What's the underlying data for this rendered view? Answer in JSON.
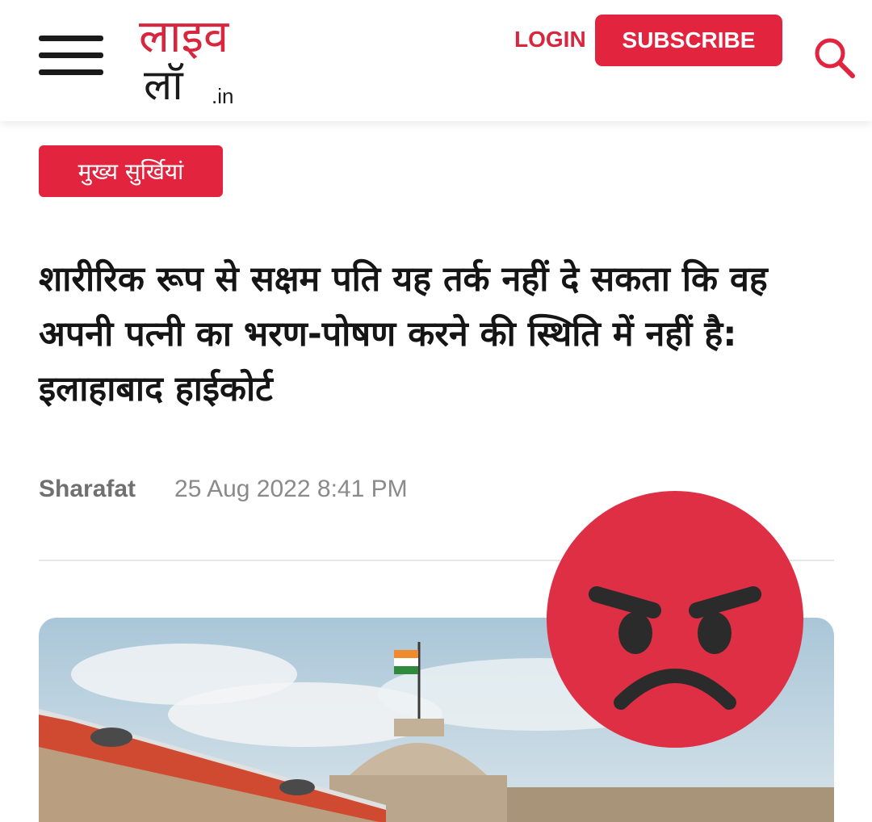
{
  "header": {
    "logo_top": "लाइव",
    "logo_bottom": "लॉ",
    "logo_suffix": ".in",
    "login_label": "LOGIN",
    "subscribe_label": "SUBSCRIBE",
    "brand_color": "#e3243f",
    "menu_icon": "hamburger-menu-icon",
    "search_icon": "search-icon"
  },
  "article": {
    "category": "मुख्य सुर्खियां",
    "headline": "शारीरिक रूप से सक्षम पति यह तर्क नहीं दे सकता कि वह अपनी पत्नी का भरण-पोषण करने की स्थिति में नहीं है: इलाहाबाद हाईकोर्ट",
    "author": "Sharafat",
    "date": "25 Aug 2022 8:41 PM"
  },
  "overlay": {
    "emoji": "angry-face-emoji",
    "emoji_color": "#de2f45"
  }
}
